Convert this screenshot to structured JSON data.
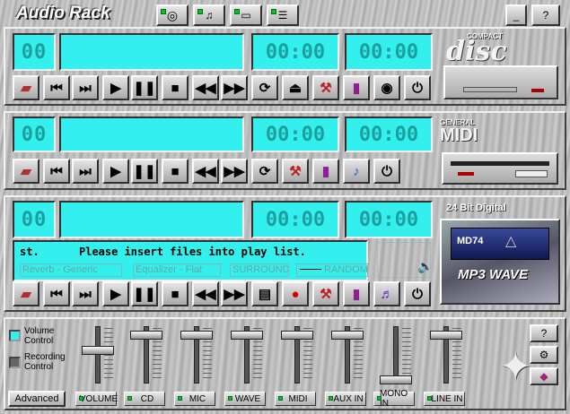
{
  "app": {
    "title": "Audio Rack",
    "help_label": "?",
    "minimize_label": "_"
  },
  "cd_player": {
    "track": "00",
    "elapsed": "00:00",
    "total": "00:00",
    "brand_small": "COMPACT",
    "brand_big": "disc"
  },
  "midi_player": {
    "track": "00",
    "elapsed": "00:00",
    "total": "00:00",
    "brand_small": "GENERAL",
    "brand_big": "MIDI"
  },
  "mp3_player": {
    "track": "00",
    "elapsed": "00:00",
    "total": "00:00",
    "status_prefix": "st.",
    "message": "Please insert files into play list.",
    "effects": [
      "Reverb - Generic",
      "Equalizer - Flat",
      "SURROUND",
      "RANDOM"
    ],
    "badge": "24 Bit Digital",
    "logo_small": "MD74",
    "logo_big": "MP3 WAVE"
  },
  "mixer": {
    "volume_control_label": "Volume Control",
    "recording_control_label": "Recording Control",
    "advanced_label": "Advanced",
    "channels": [
      "VOLUME",
      "CD",
      "MIC",
      "WAVE",
      "MIDI",
      "AUX IN",
      "MONO IN",
      "LINE IN"
    ],
    "channel_levels": [
      0.62,
      0.92,
      0.92,
      0.92,
      0.92,
      0.92,
      0.05,
      0.92
    ],
    "help_label": "?"
  },
  "colors": {
    "lcd": "#33f0ee",
    "lcd_text": "#1d9e9c",
    "panel": "#bdbdbd"
  },
  "icons": {
    "transport": [
      "folder-icon",
      "prev-icon",
      "next-icon",
      "play-icon",
      "pause-icon",
      "stop-icon",
      "rewind-icon",
      "fast-forward-icon"
    ]
  }
}
